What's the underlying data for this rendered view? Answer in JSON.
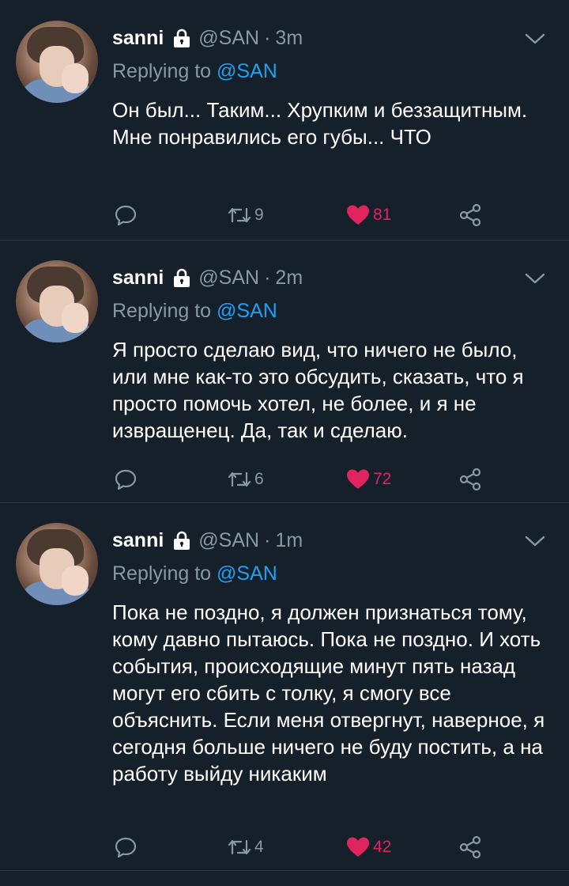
{
  "colors": {
    "background": "#15202b",
    "muted": "#8899a6",
    "accent": "#1da1f2",
    "like": "#e0245e",
    "divider": "#2c3a48"
  },
  "tweets": [
    {
      "name": "sanni",
      "handle": "@SAN",
      "separator": "·",
      "time": "3m",
      "reply_prefix": "Replying to",
      "reply_to": "@SAN",
      "text": "Он был... Таким... Хрупким и беззащитным. Мне понравились его губы... ЧТО",
      "retweets": "9",
      "likes": "81",
      "liked": true,
      "icons": [
        "lock-icon",
        "chevron-down-icon",
        "reply-icon",
        "retweet-icon",
        "heart-icon",
        "share-icon"
      ]
    },
    {
      "name": "sanni",
      "handle": "@SAN",
      "separator": "·",
      "time": "2m",
      "reply_prefix": "Replying to",
      "reply_to": "@SAN",
      "text": "Я просто сделаю вид, что ничего не было, или мне как-то это обсудить, сказать, что я просто помочь хотел, не более, и я не извращенец. Да, так и сделаю.",
      "retweets": "6",
      "likes": "72",
      "liked": true,
      "icons": [
        "lock-icon",
        "chevron-down-icon",
        "reply-icon",
        "retweet-icon",
        "heart-icon",
        "share-icon"
      ]
    },
    {
      "name": "sanni",
      "handle": "@SAN",
      "separator": "·",
      "time": "1m",
      "reply_prefix": "Replying to",
      "reply_to": "@SAN",
      "text": "Пока не поздно, я должен признаться тому, кому давно пытаюсь. Пока не поздно. И хоть события, происходящие минут пять назад могут его сбить с толку, я смогу все объяснить. Если меня отвергнут, наверное, я сегодня больше ничего не буду постить, а на работу выйду никаким",
      "retweets": "4",
      "likes": "42",
      "liked": true,
      "icons": [
        "lock-icon",
        "chevron-down-icon",
        "reply-icon",
        "retweet-icon",
        "heart-icon",
        "share-icon"
      ]
    }
  ]
}
